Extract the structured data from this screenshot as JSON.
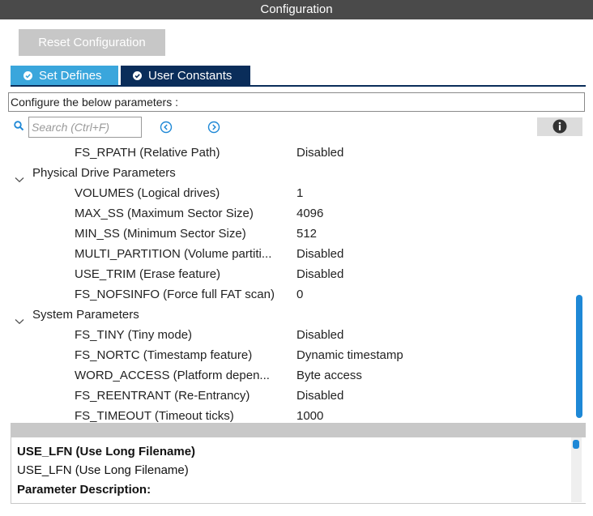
{
  "window": {
    "title": "Configuration"
  },
  "toolbar": {
    "reset_label": "Reset Configuration"
  },
  "tabs": [
    {
      "label": "Set Defines",
      "active": true
    },
    {
      "label": "User Constants",
      "active": false
    }
  ],
  "instructions": "Configure the below parameters :",
  "search": {
    "placeholder": "Search (Ctrl+F)"
  },
  "tree": {
    "rows": [
      {
        "name": "FS_RPATH (Relative Path)",
        "value": "Disabled"
      },
      {
        "group": "Physical Drive Parameters"
      },
      {
        "name": "VOLUMES (Logical drives)",
        "value": "1"
      },
      {
        "name": "MAX_SS (Maximum Sector Size)",
        "value": "4096"
      },
      {
        "name": "MIN_SS (Minimum Sector Size)",
        "value": "512"
      },
      {
        "name": "MULTI_PARTITION (Volume partiti...",
        "value": "Disabled"
      },
      {
        "name": "USE_TRIM (Erase feature)",
        "value": "Disabled"
      },
      {
        "name": "FS_NOFSINFO (Force full FAT scan)",
        "value": "0"
      },
      {
        "group": "System Parameters"
      },
      {
        "name": "FS_TINY (Tiny mode)",
        "value": "Disabled"
      },
      {
        "name": "FS_NORTC (Timestamp feature)",
        "value": "Dynamic timestamp"
      },
      {
        "name": "WORD_ACCESS (Platform depen...",
        "value": "Byte access"
      },
      {
        "name": "FS_REENTRANT (Re-Entrancy)",
        "value": "Disabled"
      },
      {
        "name": "FS_TIMEOUT (Timeout ticks)",
        "value": "1000"
      }
    ]
  },
  "description": {
    "title": "USE_LFN (Use Long Filename)",
    "subtitle": "USE_LFN (Use Long Filename)",
    "section": "Parameter Description:"
  },
  "colors": {
    "accent": "#3aa6dc",
    "dark_tab": "#0a2d5a",
    "scroll": "#1e88d6"
  },
  "icons": [
    "search-icon",
    "prev-arrow-icon",
    "next-arrow-icon",
    "info-icon",
    "chevron-down-icon",
    "checkmark-icon"
  ]
}
